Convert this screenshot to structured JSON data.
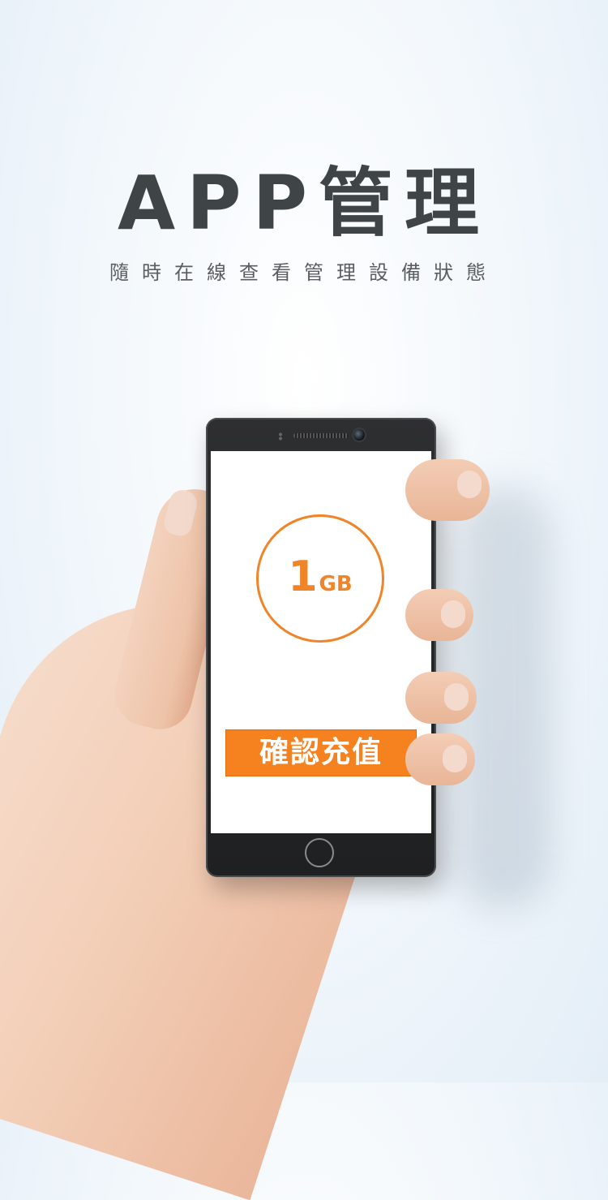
{
  "hero": {
    "title": "APP管理",
    "subtitle": "隨時在線查看管理設備狀態"
  },
  "phone_screen": {
    "data_amount": "1",
    "data_unit": "GB",
    "topup_button_label": "確認充值"
  },
  "colors": {
    "accent": "#f6811f",
    "title_text": "#3f4446",
    "phone_body": "#1f2022"
  }
}
